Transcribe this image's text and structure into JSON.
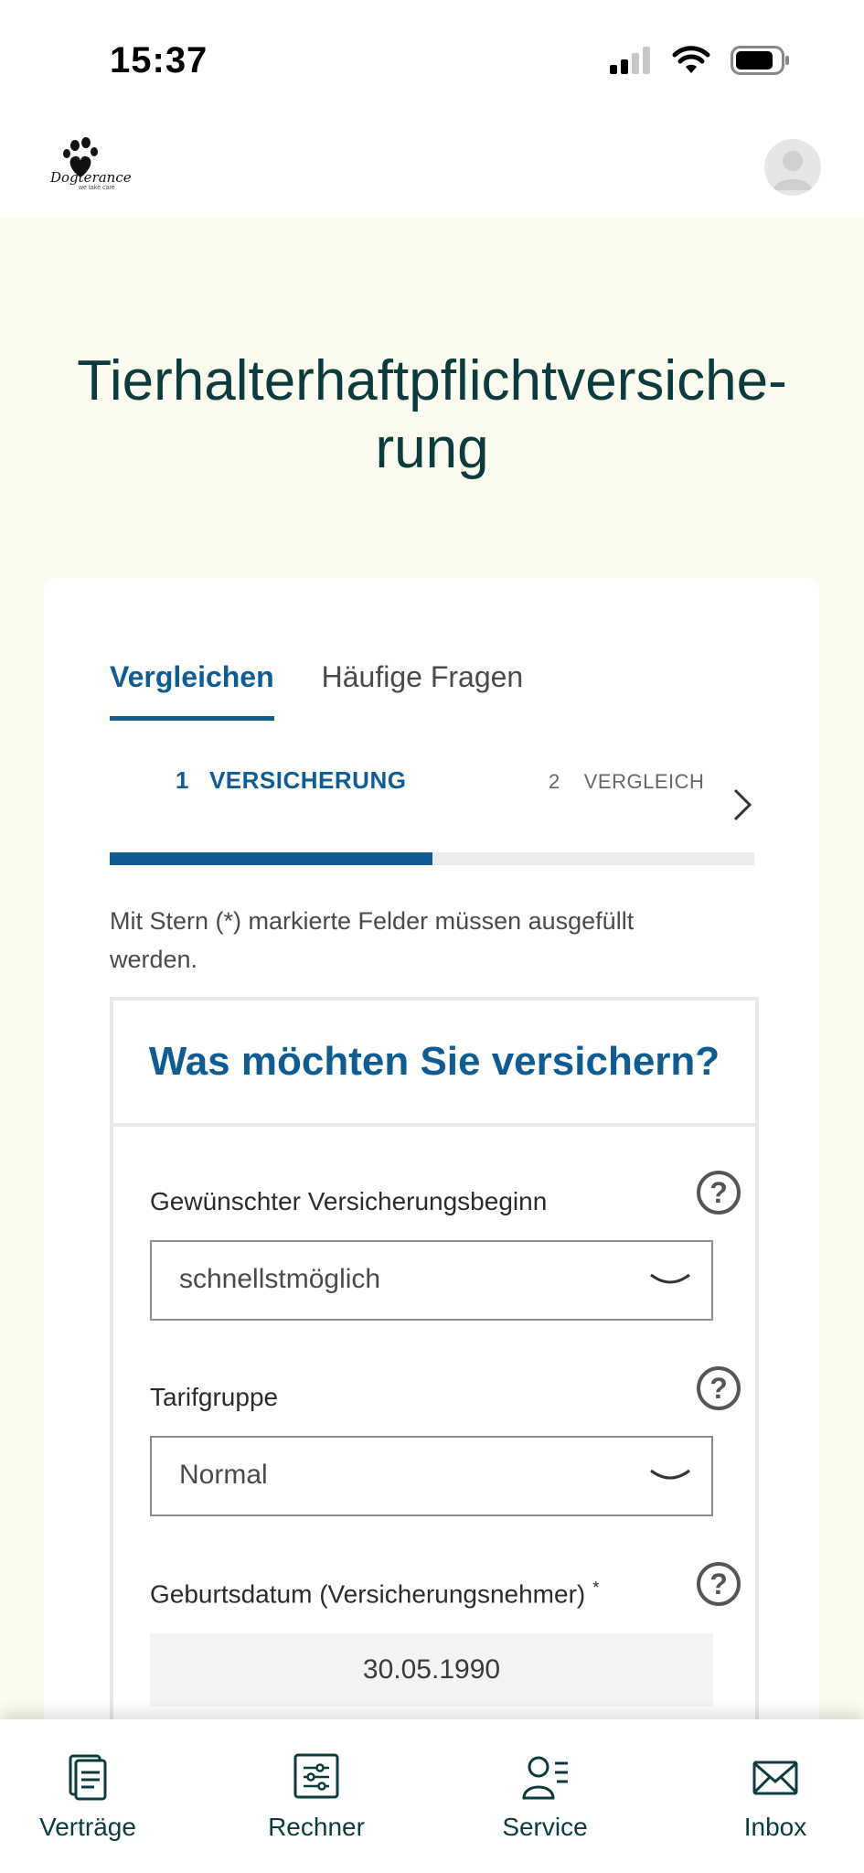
{
  "status_bar": {
    "time": "15:37"
  },
  "header": {
    "brand": "Dogterance",
    "tagline": "we take care"
  },
  "page": {
    "title_line1": "Tierhalterhaftpflichtversiche-",
    "title_line2": "rung"
  },
  "tabs": [
    {
      "label": "Vergleichen",
      "active": true
    },
    {
      "label": "Häufige Fragen",
      "active": false
    }
  ],
  "steps": [
    {
      "number": "1",
      "label": "VERSICHERUNG",
      "active": true
    },
    {
      "number": "2",
      "label": "VERGLEICH",
      "active": false
    }
  ],
  "progress": {
    "fraction": 0.5
  },
  "form": {
    "required_note": "Mit Stern (*) markierte Felder müssen ausgefüllt werden.",
    "title": "Was möchten Sie versichern?",
    "help_symbol": "?",
    "fields": {
      "start": {
        "label": "Gewünschter Versicherungsbeginn",
        "value": "schnellstmöglich"
      },
      "tariff": {
        "label": "Tarifgruppe",
        "value": "Normal"
      },
      "birthdate": {
        "label": "Geburtsdatum (Versicherungsnehmer)",
        "required_mark": "*",
        "value": "30.05.1990"
      }
    }
  },
  "bottom_nav": [
    {
      "label": "Verträge",
      "icon": "document-icon"
    },
    {
      "label": "Rechner",
      "icon": "sliders-icon"
    },
    {
      "label": "Service",
      "icon": "person-list-icon"
    },
    {
      "label": "Inbox",
      "icon": "envelope-icon"
    }
  ],
  "colors": {
    "primary": "#0f5c94",
    "title": "#0b3b3c",
    "background": "#fbfbef"
  }
}
